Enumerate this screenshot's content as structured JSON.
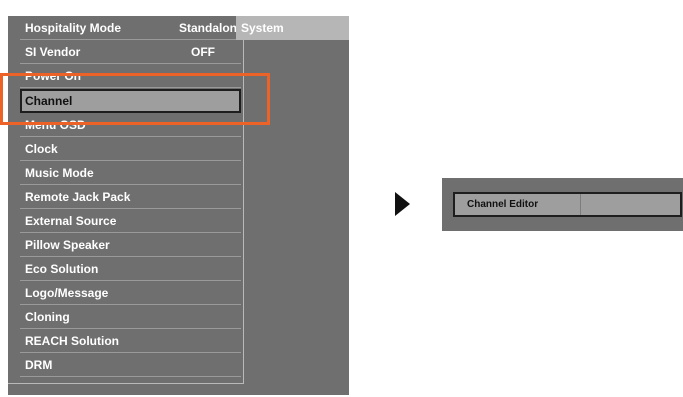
{
  "menu": {
    "header": {
      "label": "Hospitality Mode",
      "value": "Standalone"
    },
    "system_tab": "System",
    "items": [
      {
        "label": "SI Vendor",
        "value": "OFF"
      },
      {
        "label": "Power On"
      },
      {
        "label": "Channel",
        "selected": true
      },
      {
        "label": "Menu OSD"
      },
      {
        "label": "Clock"
      },
      {
        "label": "Music Mode"
      },
      {
        "label": "Remote Jack Pack"
      },
      {
        "label": "External Source"
      },
      {
        "label": "Pillow Speaker"
      },
      {
        "label": "Eco Solution"
      },
      {
        "label": "Logo/Message"
      },
      {
        "label": "Cloning"
      },
      {
        "label": "REACH Solution"
      },
      {
        "label": "DRM"
      }
    ]
  },
  "submenu": {
    "items": [
      {
        "label": "Channel Editor",
        "selected": true
      }
    ]
  },
  "colors": {
    "panel": "#6f6f6f",
    "selected": "#9e9e9e",
    "highlight": "#ec6227",
    "tab": "#b6b6b6"
  },
  "icons": {
    "arrow": "right-arrow-icon"
  }
}
